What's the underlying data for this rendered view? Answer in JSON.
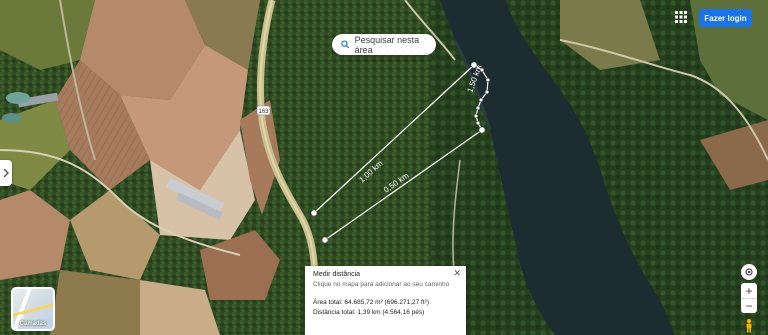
{
  "search": {
    "label": "Pesquisar nesta área"
  },
  "header": {
    "login_label": "Fazer login"
  },
  "layers": {
    "label": "Camadas"
  },
  "map": {
    "road_shield": "163",
    "measurement_labels": [
      "1,00 km",
      "0,50 km",
      "1,50 km"
    ]
  },
  "measure": {
    "title": "Medir distância",
    "subtitle": "Clique no mapa para adicionar ao seu caminho",
    "area": "Área total: 64.685,72 m² (696.271,27 ft²)",
    "distance": "Distância total: 1,39 km (4.564,16 pés)",
    "close_icon": "close-icon"
  },
  "controls": {
    "zoom_in": "+",
    "zoom_out": "−"
  },
  "colors": {
    "login_bg": "#1a73e8",
    "water": "#1c2c30",
    "forest": "#2f4a22",
    "field": "#b58a6a"
  }
}
